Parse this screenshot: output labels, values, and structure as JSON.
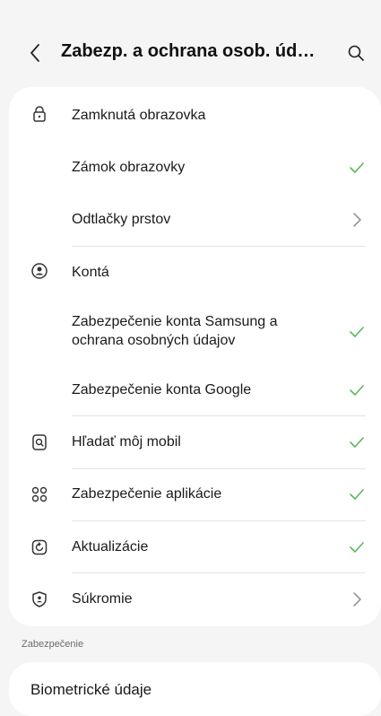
{
  "header": {
    "title": "Zabezp. a ochrana osob. úd…",
    "back_icon": "chevron-left-icon",
    "search_icon": "search-icon"
  },
  "rows": [
    {
      "label": "Zamknutá obrazovka",
      "icon": "lock-icon",
      "trail": ""
    },
    {
      "label": "Zámok obrazovky",
      "icon": "",
      "trail": "check"
    },
    {
      "label": "Odtlačky prstov",
      "icon": "",
      "trail": "chevron"
    },
    {
      "label": "Kontá",
      "icon": "account-icon",
      "trail": ""
    },
    {
      "label": "Zabezpečenie konta Samsung a ochrana osobných údajov",
      "label_line1": "Zabezpečenie konta Samsung a",
      "label_line2": "ochrana osobných údajov",
      "icon": "",
      "trail": "check"
    },
    {
      "label": "Zabezpečenie konta Google",
      "icon": "",
      "trail": "check"
    },
    {
      "label": "Hľadať môj mobil",
      "icon": "find-mobile-icon",
      "trail": "check"
    },
    {
      "label": "Zabezpečenie aplikácie",
      "icon": "app-security-icon",
      "trail": "check"
    },
    {
      "label": "Aktualizácie",
      "icon": "update-icon",
      "trail": "check"
    },
    {
      "label": "Súkromie",
      "icon": "privacy-icon",
      "trail": "chevron"
    }
  ],
  "section": {
    "label": "Zabezpečenie",
    "first_item": "Biometrické údaje"
  },
  "colors": {
    "check": "#5cb85c",
    "chevron": "#8a8a8a",
    "background": "#f5f5f5",
    "card": "#ffffff"
  }
}
